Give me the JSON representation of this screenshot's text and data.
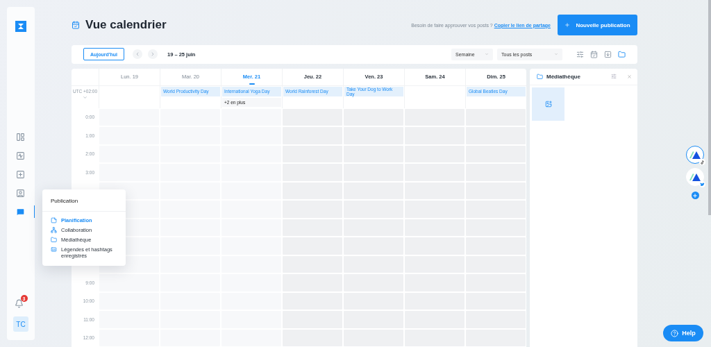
{
  "sidebar": {
    "nav_items": [
      {
        "selected": false
      },
      {
        "selected": false
      },
      {
        "selected": false
      },
      {
        "selected": false
      },
      {
        "selected": true
      }
    ],
    "notifications_badge": "3",
    "avatar": "TC"
  },
  "menu": {
    "title": "Publication",
    "items": [
      {
        "label": "Planification",
        "selected": true
      },
      {
        "label": "Collaboration",
        "selected": false
      },
      {
        "label": "Médiathèque",
        "selected": false
      },
      {
        "label": "Légendes et hashtags enregistrés",
        "selected": false
      }
    ]
  },
  "header": {
    "title": "Vue calendrier",
    "approval_text": "Besoin de faire approuver vos posts ?",
    "share_link": "Copier le lien de partage",
    "new_post_button": "Nouvelle publication"
  },
  "toolbar": {
    "today_button": "Aujourd'hui",
    "date_range": "19 – 25 juin",
    "view_select": "Semaine",
    "posts_select": "Tous les posts"
  },
  "calendar": {
    "timezone": "UTC +02:00",
    "days": [
      {
        "label": "Lun. 19",
        "kind": "past"
      },
      {
        "label": "Mar. 20",
        "kind": "past",
        "events": [
          "World Productivity Day"
        ]
      },
      {
        "label": "Mer. 21",
        "kind": "today",
        "events": [
          "International Yoga Day"
        ],
        "more": "+2 en plus"
      },
      {
        "label": "Jeu. 22",
        "kind": "future",
        "events": [
          "World Rainforest Day"
        ]
      },
      {
        "label": "Ven. 23",
        "kind": "future",
        "events": [
          "Take Your Dog to Work Day"
        ]
      },
      {
        "label": "Sam. 24",
        "kind": "future"
      },
      {
        "label": "Dim. 25",
        "kind": "future",
        "events": [
          "Global Beatles Day"
        ]
      }
    ],
    "time_rows": [
      "0:00",
      "1:00",
      "2:00",
      "3:00",
      null,
      null,
      null,
      null,
      null,
      "9:00",
      "10:00",
      "11:00",
      "12:00"
    ]
  },
  "media_panel": {
    "title": "Médiathèque"
  },
  "accounts": [
    {
      "kind": "tiktok",
      "selected": true
    },
    {
      "kind": "twitter",
      "selected": false
    }
  ],
  "help_button": "Help"
}
